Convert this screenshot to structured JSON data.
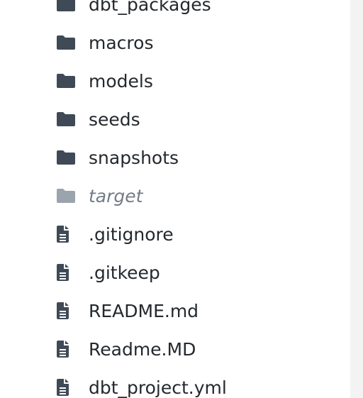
{
  "colors": {
    "folder": "#3f4a56",
    "folder_ignored": "#9ba3ad",
    "file": "#3f4a56",
    "text": "#24292e",
    "text_ignored": "#737b85"
  },
  "items": [
    {
      "name": "dbt_packages",
      "type": "folder",
      "icon": "folder-icon",
      "ignored": false,
      "partially_visible": true
    },
    {
      "name": "macros",
      "type": "folder",
      "icon": "folder-icon",
      "ignored": false
    },
    {
      "name": "models",
      "type": "folder",
      "icon": "folder-icon",
      "ignored": false
    },
    {
      "name": "seeds",
      "type": "folder",
      "icon": "folder-icon",
      "ignored": false
    },
    {
      "name": "snapshots",
      "type": "folder",
      "icon": "folder-icon",
      "ignored": false
    },
    {
      "name": "target",
      "type": "folder",
      "icon": "folder-icon",
      "ignored": true
    },
    {
      "name": ".gitignore",
      "type": "file",
      "icon": "file-icon",
      "ignored": false
    },
    {
      "name": ".gitkeep",
      "type": "file",
      "icon": "file-icon",
      "ignored": false
    },
    {
      "name": "README.md",
      "type": "file",
      "icon": "file-icon",
      "ignored": false
    },
    {
      "name": "Readme.MD",
      "type": "file",
      "icon": "file-icon",
      "ignored": false
    },
    {
      "name": "dbt_project.yml",
      "type": "file",
      "icon": "file-icon",
      "ignored": false
    }
  ]
}
